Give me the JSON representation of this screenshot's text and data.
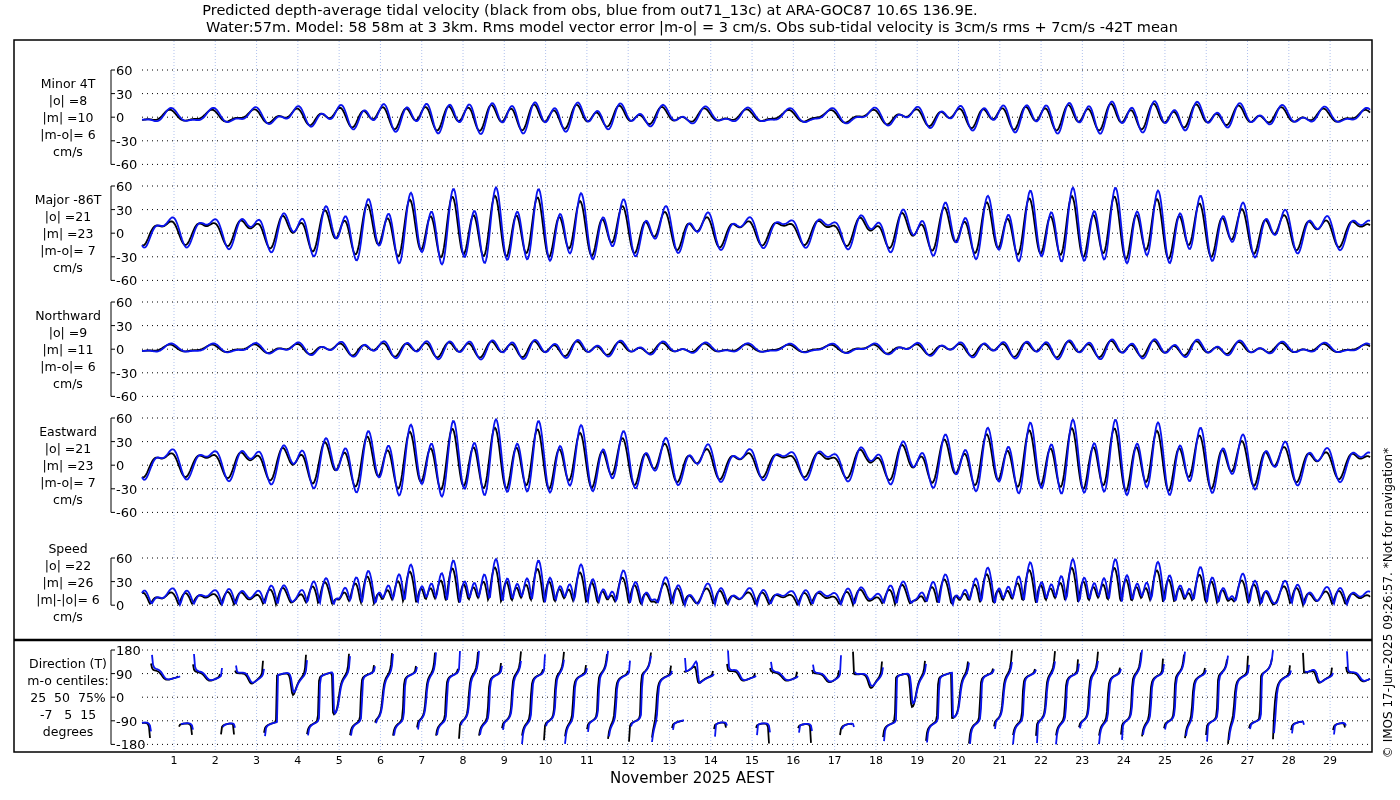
{
  "title": {
    "line_1": "Predicted depth-average tidal velocity (black from obs, blue from out71_13c) at ARA-GOC87 10.6S 136.9E.",
    "line_2": "Water:57m. Model: 58 58m at 3 3km. Rms model vector error |m-o| = 3 cm/s. Obs sub-tidal velocity is 3cm/s rms + 7cm/s -42T mean"
  },
  "panels": [
    {
      "kind": "velocity",
      "label_lines": [
        "Minor 4T",
        "|o| =8",
        "|m| =10",
        "|m-o|= 6",
        "cm/s"
      ],
      "yticks": [
        "60",
        "30",
        "0",
        "-30",
        "-60"
      ]
    },
    {
      "kind": "velocity",
      "label_lines": [
        "Major -86T",
        "|o| =21",
        "|m| =23",
        "|m-o|= 7",
        "cm/s"
      ],
      "yticks": [
        "60",
        "30",
        "0",
        "-30",
        "-60"
      ]
    },
    {
      "kind": "velocity",
      "label_lines": [
        "Northward",
        "|o| =9",
        "|m| =11",
        "|m-o|= 6",
        "cm/s"
      ],
      "yticks": [
        "60",
        "30",
        "0",
        "-30",
        "-60"
      ]
    },
    {
      "kind": "velocity",
      "label_lines": [
        "Eastward",
        "|o| =21",
        "|m| =23",
        "|m-o|= 7",
        "cm/s"
      ],
      "yticks": [
        "60",
        "30",
        "0",
        "-30",
        "-60"
      ]
    },
    {
      "kind": "speed",
      "label_lines": [
        "Speed",
        "|o| =22",
        "|m| =26",
        "|m|-|o|= 6",
        "cm/s"
      ],
      "yticks": [
        "60",
        "30",
        "0"
      ]
    },
    {
      "kind": "direction",
      "label_lines": [
        "Direction (T)",
        "m-o centiles:",
        "25  50  75%",
        "-7   5  15",
        "degrees"
      ],
      "yticks": [
        "180",
        "90",
        "0",
        "-90",
        "-180"
      ]
    }
  ],
  "xticks": [
    "1",
    "2",
    "3",
    "4",
    "5",
    "6",
    "7",
    "8",
    "9",
    "10",
    "11",
    "12",
    "13",
    "14",
    "15",
    "16",
    "17",
    "18",
    "19",
    "20",
    "21",
    "22",
    "23",
    "24",
    "25",
    "26",
    "27",
    "28",
    "29"
  ],
  "xlabel": "November 2025 AEST",
  "credit": "© IMOS 17-Jun-2025 09:26:57. *Not for navigation*"
}
